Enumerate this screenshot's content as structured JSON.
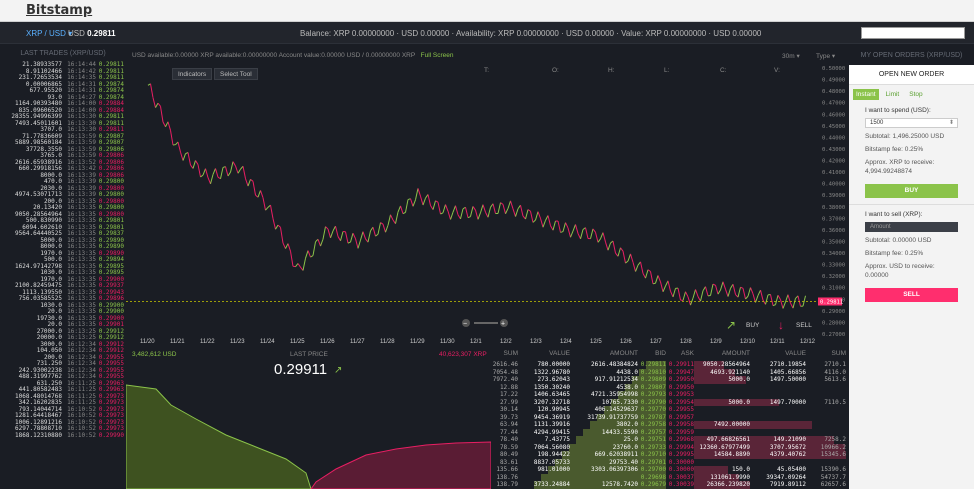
{
  "logo": "Bitstamp",
  "pair": {
    "label": "XRP / USD",
    "price_prefix": "USD",
    "price": "0.29811"
  },
  "balance_text": "Balance: XRP 0.00000000 · USD 0.00000 · Availability: XRP 0.00000000 · USD 0.00000 · Value: XRP 0.00000000 · USD 0.00000",
  "last_trades": {
    "title": "LAST TRADES (XRP/USD)",
    "rows": [
      [
        "21.38933577",
        "16:14:44",
        "0.29811",
        "up"
      ],
      [
        "8.91102466",
        "16:14:42",
        "0.29811",
        "up"
      ],
      [
        "231.72653534",
        "16:14:35",
        "0.29811",
        "up"
      ],
      [
        "0.00006865",
        "16:14:31",
        "0.29874",
        "up"
      ],
      [
        "677.95520",
        "16:14:31",
        "0.29874",
        "up"
      ],
      [
        "93.0",
        "16:14:27",
        "0.29874",
        "up"
      ],
      [
        "1164.90393480",
        "16:14:00",
        "0.29884",
        "dn"
      ],
      [
        "835.09606520",
        "16:14:00",
        "0.29884",
        "dn"
      ],
      [
        "28355.94996399",
        "16:13:30",
        "0.29811",
        "up"
      ],
      [
        "7493.45011601",
        "16:13:30",
        "0.29811",
        "up"
      ],
      [
        "3707.0",
        "16:13:30",
        "0.29811",
        "dn"
      ],
      [
        "71.77836609",
        "16:13:59",
        "0.29807",
        "up"
      ],
      [
        "5889.98560184",
        "16:13:59",
        "0.29807",
        "up"
      ],
      [
        "37728.3550",
        "16:13:59",
        "0.29806",
        "up"
      ],
      [
        "3765.0",
        "16:13:59",
        "0.29806",
        "dn"
      ],
      [
        "2616.65938916",
        "16:13:52",
        "0.29806",
        "dn"
      ],
      [
        "660.29918156",
        "16:13:42",
        "0.29806",
        "dn"
      ],
      [
        "8000.0",
        "16:13:39",
        "0.29806",
        "dn"
      ],
      [
        "470.0",
        "16:13:39",
        "0.29800",
        "up"
      ],
      [
        "2030.0",
        "16:13:39",
        "0.29800",
        "dn"
      ],
      [
        "4974.53071713",
        "16:13:39",
        "0.29800",
        "up"
      ],
      [
        "200.0",
        "16:13:35",
        "0.29800",
        "dn"
      ],
      [
        "20.13420",
        "16:13:35",
        "0.29800",
        "up"
      ],
      [
        "9050.28564964",
        "16:13:35",
        "0.29800",
        "dn"
      ],
      [
        "500.830990",
        "16:13:35",
        "0.29801",
        "up"
      ],
      [
        "6094.602610",
        "16:13:35",
        "0.29801",
        "up"
      ],
      [
        "9564.64440525",
        "16:13:35",
        "0.29837",
        "up"
      ],
      [
        "5000.0",
        "16:13:35",
        "0.29890",
        "up"
      ],
      [
        "8000.0",
        "16:13:35",
        "0.29890",
        "up"
      ],
      [
        "1970.0",
        "16:13:35",
        "0.29890",
        "dn"
      ],
      [
        "500.0",
        "16:13:35",
        "0.29894",
        "up"
      ],
      [
        "1624.97142798",
        "16:13:35",
        "0.29895",
        "up"
      ],
      [
        "1030.0",
        "16:13:35",
        "0.29895",
        "up"
      ],
      [
        "1970.0",
        "16:13:35",
        "0.29900",
        "dn"
      ],
      [
        "2100.82459475",
        "16:13:35",
        "0.29937",
        "dn"
      ],
      [
        "1113.139550",
        "16:13:35",
        "0.29943",
        "dn"
      ],
      [
        "756.03585525",
        "16:13:35",
        "0.29896",
        "dn"
      ],
      [
        "1030.0",
        "16:13:35",
        "0.29900",
        "up"
      ],
      [
        "20.0",
        "16:13:35",
        "0.29900",
        "up"
      ],
      [
        "19730.0",
        "16:13:35",
        "0.29900",
        "dn"
      ],
      [
        "20.0",
        "16:13:35",
        "0.29901",
        "dn"
      ],
      [
        "27000.0",
        "16:13:25",
        "0.29912",
        "up"
      ],
      [
        "20000.0",
        "16:13:25",
        "0.29912",
        "up"
      ],
      [
        "3000.0",
        "16:12:34",
        "0.29912",
        "dn"
      ],
      [
        "104.050",
        "16:12:34",
        "0.29912",
        "dn"
      ],
      [
        "200.0",
        "16:12:34",
        "0.29955",
        "dn"
      ],
      [
        "731.250",
        "16:12:34",
        "0.29955",
        "dn"
      ],
      [
        "242.93002238",
        "16:12:34",
        "0.29955",
        "dn"
      ],
      [
        "488.31997762",
        "16:12:34",
        "0.29955",
        "dn"
      ],
      [
        "631.250",
        "16:11:25",
        "0.29963",
        "dn"
      ],
      [
        "441.80582483",
        "16:11:25",
        "0.29963",
        "dn"
      ],
      [
        "1068.48014768",
        "16:11:25",
        "0.29973",
        "dn"
      ],
      [
        "342.16202835",
        "16:11:25",
        "0.29973",
        "dn"
      ],
      [
        "793.14044714",
        "16:10:52",
        "0.29973",
        "dn"
      ],
      [
        "1281.64418467",
        "16:10:52",
        "0.29973",
        "dn"
      ],
      [
        "1006.12891216",
        "16:10:52",
        "0.29973",
        "dn"
      ],
      [
        "6297.78808710",
        "16:10:52",
        "0.29973",
        "dn"
      ],
      [
        "1868.12310880",
        "16:10:52",
        "0.29990",
        "dn"
      ]
    ]
  },
  "chart": {
    "info": "USD available:0.00000   XRP available:0.00000000   Account value:0.00000 USD / 0.00000000 XRP",
    "fullscreen": "Full Screen",
    "timeframe": "30m",
    "type_label": "Type",
    "indicators_label": "Indicators",
    "select_tool_label": "Select Tool",
    "ohlc_labels": [
      "T:",
      "O:",
      "H:",
      "L:",
      "C:",
      "V:"
    ],
    "current_price": "0.29811",
    "buy_label": "BUY",
    "sell_label": "SELL"
  },
  "chart_data": {
    "type": "line",
    "title": "",
    "x": [
      "11/20",
      "11/21",
      "11/22",
      "11/23",
      "11/24",
      "11/25",
      "11/26",
      "11/27",
      "11/28",
      "11/29",
      "11/30",
      "12/1",
      "12/2",
      "12/3",
      "12/4",
      "12/5",
      "12/6",
      "12/7",
      "12/8",
      "12/9",
      "12/10",
      "12/11",
      "12/12"
    ],
    "series": [
      {
        "values": [
          0.485,
          0.43,
          0.405,
          0.415,
          0.38,
          0.325,
          0.36,
          0.35,
          0.365,
          0.39,
          0.375,
          0.375,
          0.38,
          0.37,
          0.36,
          0.355,
          0.335,
          0.315,
          0.3,
          0.31,
          0.305,
          0.298,
          0.298
        ]
      }
    ],
    "ylim": [
      0.27,
      0.5
    ],
    "yticks": [
      "0.50000",
      "0.49000",
      "0.48000",
      "0.47000",
      "0.46000",
      "0.45000",
      "0.44000",
      "0.43000",
      "0.42000",
      "0.41000",
      "0.40000",
      "0.39000",
      "0.38000",
      "0.37000",
      "0.36000",
      "0.35000",
      "0.34000",
      "0.33000",
      "0.32000",
      "0.31000",
      "0.30000",
      "0.29000",
      "0.28000",
      "0.27000"
    ]
  },
  "depth": {
    "bids_total": "3,482,612 USD",
    "last_price_label": "LAST PRICE",
    "last_price": "0.29911",
    "asks_total": "40,623,307 XRP"
  },
  "orderbook": {
    "headers": [
      "SUM",
      "VALUE",
      "AMOUNT",
      "BID",
      "ASK",
      "AMOUNT",
      "VALUE",
      "SUM"
    ],
    "rows": [
      [
        "2616.46",
        "780.00000",
        "2616.48384824",
        "0.29811",
        "0.29911",
        "9050.28564964",
        "2710.19854",
        "2710.1"
      ],
      [
        "7054.48",
        "1322.96780",
        "4438.0",
        "0.29810",
        "0.29947",
        "4693.921140",
        "1405.66856",
        "4116.0"
      ],
      [
        "7972.40",
        "273.62043",
        "917.91212534",
        "0.29809",
        "0.29950",
        "5000.0",
        "1497.50000",
        "5613.6"
      ],
      [
        "12.88",
        "1350.30240",
        "4538.0",
        "0.29807",
        "0.29950",
        "",
        "",
        ""
      ],
      [
        "17.22",
        "1406.63465",
        "4721.35954998",
        "0.29793",
        "0.29953",
        "",
        "",
        ""
      ],
      [
        "27.99",
        "3207.32718",
        "10765.7330",
        "0.29790",
        "0.29954",
        "5000.0",
        "1497.70000",
        "7110.5"
      ],
      [
        "30.14",
        "120.90945",
        "406.14529637",
        "0.29770",
        "0.29955",
        "",
        "",
        ""
      ],
      [
        "39.73",
        "9454.36919",
        "31739.91737759",
        "0.29787",
        "0.29957",
        "",
        "",
        ""
      ],
      [
        "63.94",
        "1131.39916",
        "3802.0",
        "0.29758",
        "0.29958",
        "7492.00000",
        "",
        ""
      ],
      [
        "77.44",
        "4294.99415",
        "14433.5590",
        "0.29757",
        "0.29959",
        "",
        "",
        ""
      ],
      [
        "78.40",
        "7.43775",
        "25.0",
        "0.29751",
        "0.29968",
        "497.66826561",
        "149.21090",
        "7258.2"
      ],
      [
        "78.59",
        "7064.56080",
        "23760.0",
        "0.29733",
        "0.29994",
        "12360.67977499",
        "3707.95672",
        "10966.2"
      ],
      [
        "80.49",
        "198.94422",
        "669.62038911",
        "0.29710",
        "0.29995",
        "14584.8890",
        "4379.40762",
        "15345.6"
      ],
      [
        "83.61",
        "8837.05733",
        "29753.40",
        "0.29701",
        "0.30000",
        "",
        "",
        ""
      ],
      [
        "135.66",
        "981.01000",
        "3303.06397306",
        "0.29700",
        "0.30000",
        "150.0",
        "45.05400",
        "15390.6"
      ],
      [
        "138.76",
        "",
        "",
        "0.29698",
        "0.30037",
        "131061.9990",
        "39347.09264",
        "54737.7"
      ],
      [
        "138.79",
        "3733.24884",
        "12578.7420",
        "0.29679",
        "0.30039",
        "26366.239820",
        "7919.89112",
        "62657.6"
      ]
    ]
  }
}
